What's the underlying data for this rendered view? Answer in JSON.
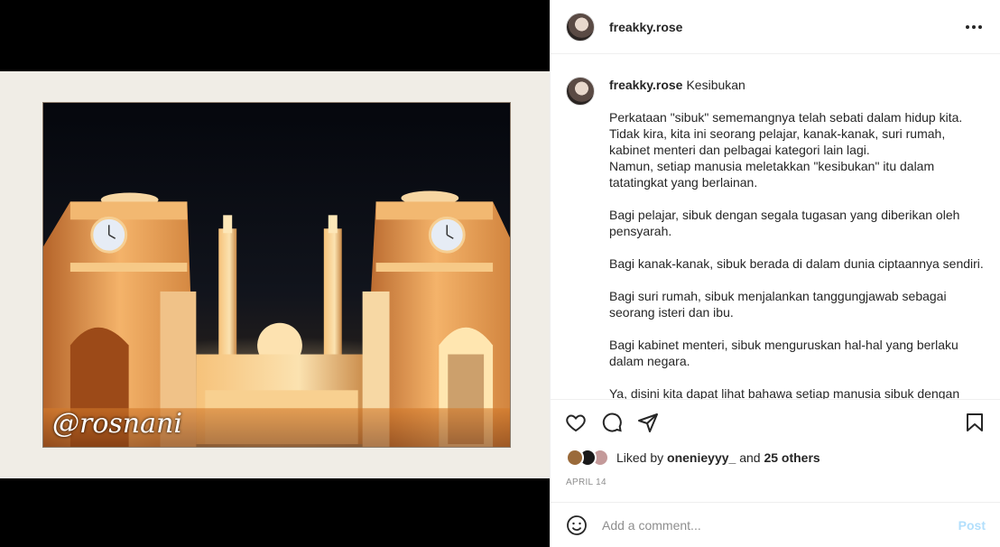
{
  "post": {
    "username": "freakky.rose",
    "watermark": "@rosnani",
    "caption_title": "Kesibukan",
    "caption_paragraphs": [
      "Perkataan \"sibuk\" sememangnya telah sebati dalam hidup kita.\nTidak kira, kita ini seorang pelajar, kanak-kanak, suri rumah, kabinet menteri dan pelbagai kategori lain lagi.\nNamun, setiap manusia meletakkan \"kesibukan\" itu dalam tatatingkat yang berlainan.",
      "Bagi pelajar, sibuk dengan segala tugasan yang diberikan oleh pensyarah.",
      "Bagi kanak-kanak, sibuk berada di dalam dunia ciptaannya sendiri.",
      "Bagi suri rumah, sibuk menjalankan tanggungjawab sebagai seorang isteri dan ibu.",
      "Bagi kabinet menteri, sibuk menguruskan hal-hal yang berlaku dalam negara.",
      "Ya, disini kita dapat lihat bahawa setiap manusia sibuk dengan cara"
    ],
    "likes": {
      "prefix": "Liked by",
      "user": "onenieyyy_",
      "connector": "and",
      "others": "25 others"
    },
    "date": "APRIL 14"
  },
  "comment": {
    "placeholder": "Add a comment...",
    "post_label": "Post"
  },
  "icons": {
    "more": "more-options-icon",
    "like": "heart-icon",
    "comment": "comment-icon",
    "share": "paper-plane-icon",
    "save": "bookmark-icon",
    "emoji": "emoji-icon"
  },
  "colors": {
    "accent_disabled": "#b2dffc",
    "muted": "#8e8e8e",
    "text": "#262626"
  }
}
